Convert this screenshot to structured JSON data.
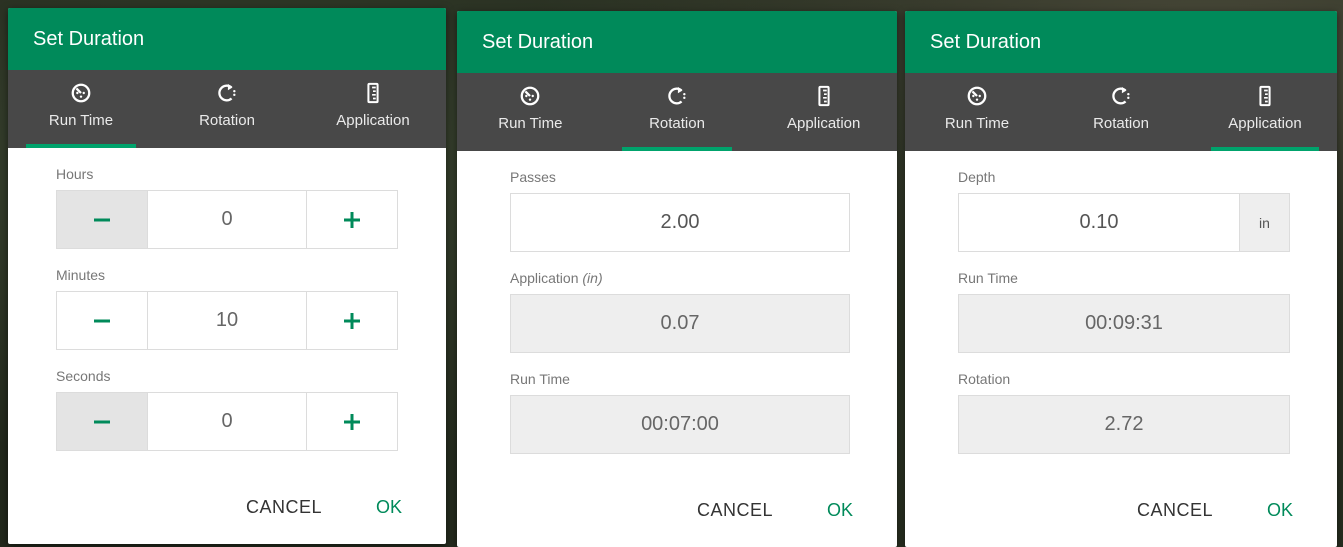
{
  "colors": {
    "accent": "#008a5a",
    "tabbar": "#484848",
    "tab_indicator": "#00a36c"
  },
  "dialogs": [
    {
      "title": "Set Duration",
      "tabs": [
        {
          "label": "Run Time",
          "icon": "timer-icon",
          "active": true
        },
        {
          "label": "Rotation",
          "icon": "rotation-icon",
          "active": false
        },
        {
          "label": "Application",
          "icon": "ruler-icon",
          "active": false
        }
      ],
      "fields": [
        {
          "label": "Hours",
          "value": "0",
          "minus": "−",
          "plus": "+",
          "minus_disabled": true
        },
        {
          "label": "Minutes",
          "value": "10",
          "minus": "−",
          "plus": "+",
          "minus_disabled": false
        },
        {
          "label": "Seconds",
          "value": "0",
          "minus": "−",
          "plus": "+",
          "minus_disabled": true
        }
      ],
      "cancel_label": "CANCEL",
      "ok_label": "OK"
    },
    {
      "title": "Set Duration",
      "tabs": [
        {
          "label": "Run Time",
          "icon": "timer-icon",
          "active": false
        },
        {
          "label": "Rotation",
          "icon": "rotation-icon",
          "active": true
        },
        {
          "label": "Application",
          "icon": "ruler-icon",
          "active": false
        }
      ],
      "fields": [
        {
          "label": "Passes",
          "value": "2.00"
        },
        {
          "label": "Application",
          "unit_hint": "(in)",
          "value": "0.07"
        },
        {
          "label": "Run Time",
          "value": "00:07:00"
        }
      ],
      "cancel_label": "CANCEL",
      "ok_label": "OK"
    },
    {
      "title": "Set Duration",
      "tabs": [
        {
          "label": "Run Time",
          "icon": "timer-icon",
          "active": false
        },
        {
          "label": "Rotation",
          "icon": "rotation-icon",
          "active": false
        },
        {
          "label": "Application",
          "icon": "ruler-icon",
          "active": true
        }
      ],
      "fields": [
        {
          "label": "Depth",
          "value": "0.10",
          "unit": "in"
        },
        {
          "label": "Run Time",
          "value": "00:09:31"
        },
        {
          "label": "Rotation",
          "value": "2.72"
        }
      ],
      "cancel_label": "CANCEL",
      "ok_label": "OK"
    }
  ]
}
